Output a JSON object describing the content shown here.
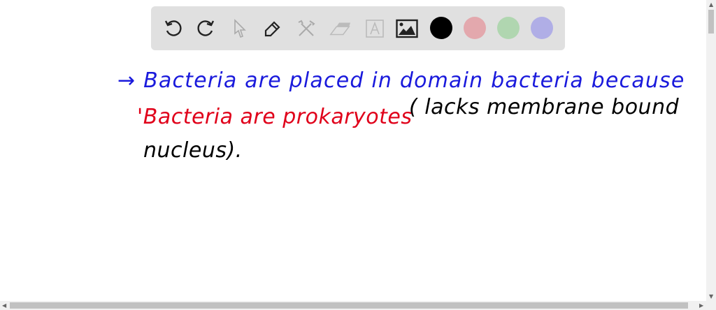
{
  "toolbar": {
    "tools": [
      "undo-icon",
      "redo-icon",
      "select-icon",
      "pen-icon",
      "tools-icon",
      "eraser-icon",
      "text-icon",
      "image-icon"
    ],
    "colors": [
      "#000000",
      "#e3a8ad",
      "#b0d6b0",
      "#b0aee6"
    ]
  },
  "canvas": {
    "line1": "→ Bacteria are placed in domain bacteria because",
    "line2_red": "'Bacteria are prokaryotes",
    "line2_black": "( lacks membrane bound",
    "line3": "nucleus).",
    "colors": {
      "blue": "#1a1adc",
      "red": "#e0001a",
      "black": "#000000"
    }
  }
}
